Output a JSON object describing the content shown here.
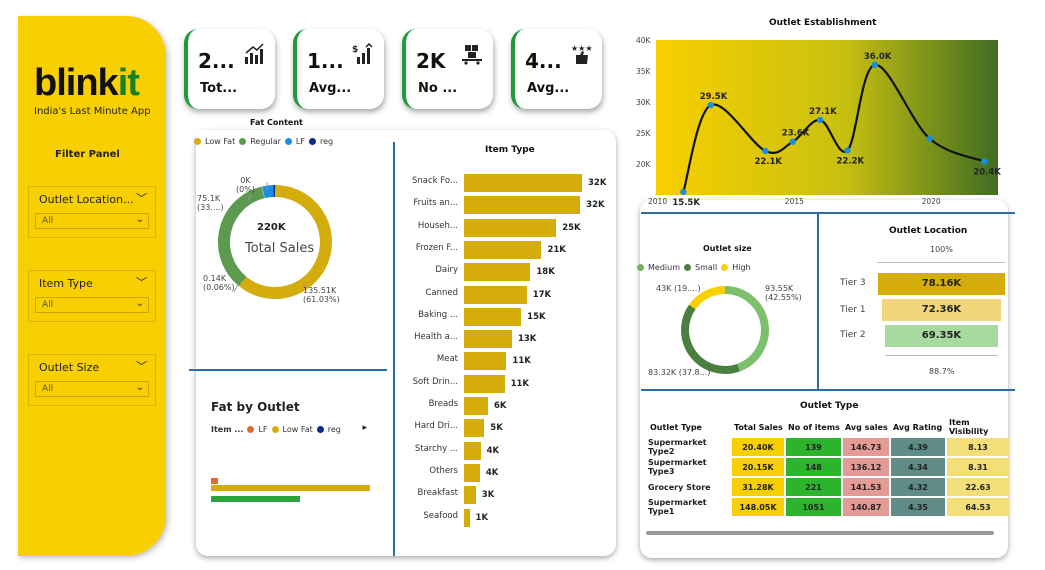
{
  "brand": {
    "logo_main": "blink",
    "logo_accent": "it",
    "tagline": "India's Last Minute App"
  },
  "filter_panel": {
    "title": "Filter Panel",
    "slicers": [
      {
        "label": "Outlet Location...",
        "value": "All"
      },
      {
        "label": "Item Type",
        "value": "All"
      },
      {
        "label": "Outlet Size",
        "value": "All"
      }
    ]
  },
  "kpis": [
    {
      "value": "2...",
      "caption": "Tot...",
      "icon": "money-growth-icon"
    },
    {
      "value": "1...",
      "caption": "Avg...",
      "icon": "dollar-chart-icon"
    },
    {
      "value": "2K",
      "caption": "No ...",
      "icon": "boxes-cart-icon"
    },
    {
      "value": "4...",
      "caption": "Avg...",
      "icon": "rating-stars-icon"
    }
  ],
  "colors": {
    "yellow": "#f8cf00",
    "mustard": "#d4ad0c",
    "green": "#5c9a4f",
    "blue": "#1a8fe0",
    "navy": "#0b2a8a",
    "orange": "#e06c2e"
  },
  "fat_content": {
    "title": "Fat Content",
    "legend": [
      "Low Fat",
      "Regular",
      "LF",
      "reg"
    ],
    "center_value": "220K",
    "center_label": "Total Sales",
    "labels": {
      "low_fat": [
        "135.51K",
        "(61.03%)"
      ],
      "regular": [
        "75.1K",
        "(33....)"
      ],
      "lf": [
        "0K",
        "(0%)"
      ],
      "reg": [
        "0.14K",
        "(0.06%)"
      ]
    }
  },
  "fat_by_outlet": {
    "title": "Fat by Outlet",
    "legend_title": "Item ...",
    "legend": [
      "LF",
      "Low Fat",
      "reg"
    ],
    "more": "▸"
  },
  "item_type": {
    "title": "Item Type",
    "rows": [
      {
        "name": "Snack Fo...",
        "label": "32K",
        "value": 32
      },
      {
        "name": "Fruits an...",
        "label": "32K",
        "value": 31.5
      },
      {
        "name": "Househ...",
        "label": "25K",
        "value": 25
      },
      {
        "name": "Frozen F...",
        "label": "21K",
        "value": 21
      },
      {
        "name": "Dairy",
        "label": "18K",
        "value": 18
      },
      {
        "name": "Canned",
        "label": "17K",
        "value": 17
      },
      {
        "name": "Baking ...",
        "label": "15K",
        "value": 15.5
      },
      {
        "name": "Health a...",
        "label": "13K",
        "value": 13
      },
      {
        "name": "Meat",
        "label": "11K",
        "value": 11.5
      },
      {
        "name": "Soft Drin...",
        "label": "11K",
        "value": 11
      },
      {
        "name": "Breads",
        "label": "6K",
        "value": 6.5
      },
      {
        "name": "Hard Dri...",
        "label": "5K",
        "value": 5.5
      },
      {
        "name": "Starchy ...",
        "label": "4K",
        "value": 4.5
      },
      {
        "name": "Others",
        "label": "4K",
        "value": 4.3
      },
      {
        "name": "Breakfast",
        "label": "3K",
        "value": 3.2
      },
      {
        "name": "Seafood",
        "label": "1K",
        "value": 1.5
      }
    ]
  },
  "chart_data": {
    "type": "line",
    "title": "Outlet Establishment",
    "x": [
      2011,
      2012,
      2014,
      2015,
      2016,
      2017,
      2018,
      2020,
      2022
    ],
    "values": [
      15.5,
      29.5,
      22.1,
      23.6,
      27.1,
      22.2,
      36.0,
      24.1,
      20.4
    ],
    "data_labels": [
      "15.5K",
      "29.5K",
      "22.1K",
      "23.6K",
      "27.1K",
      "22.2K",
      "36.0K",
      "",
      "20.4K"
    ],
    "y_ticks": [
      "40K",
      "35K",
      "30K",
      "25K",
      "20K"
    ],
    "x_ticks": [
      "2010",
      "2015",
      "2020"
    ],
    "xlim": [
      2010,
      2022.5
    ],
    "ylim": [
      15,
      40
    ]
  },
  "outlet_size": {
    "title": "Outlet size",
    "legend": [
      "Medium",
      "Small",
      "High"
    ],
    "labels": {
      "medium": [
        "93.55K",
        "(42.55%)"
      ],
      "small": [
        "83.32K (37.8...)"
      ],
      "high": [
        "43K (19....)"
      ]
    },
    "shares": [
      42.55,
      37.88,
      19.57
    ]
  },
  "outlet_location": {
    "title": "Outlet Location",
    "top_pct": "100%",
    "bottom_pct": "88.7%",
    "rows": [
      {
        "tier": "Tier 3",
        "label": "78.16K",
        "color": "#d4ad0c"
      },
      {
        "tier": "Tier 1",
        "label": "72.36K",
        "color": "#f2d57a"
      },
      {
        "tier": "Tier 2",
        "label": "69.35K",
        "color": "#a8d9a0"
      }
    ]
  },
  "outlet_type": {
    "title": "Outlet Type",
    "headers": [
      "Outlet Type",
      "Total Sales",
      "No of items",
      "Avg sales",
      "Avg Rating",
      "Item Visibility"
    ],
    "rows": [
      [
        "Supermarket Type2",
        "20.40K",
        "139",
        "146.73",
        "4.39",
        "8.13"
      ],
      [
        "Supermarket Type3",
        "20.15K",
        "148",
        "136.12",
        "4.34",
        "8.31"
      ],
      [
        "Grocery Store",
        "31.28K",
        "221",
        "141.53",
        "4.32",
        "22.63"
      ],
      [
        "Supermarket Type1",
        "148.05K",
        "1051",
        "140.87",
        "4.35",
        "64.53"
      ]
    ]
  }
}
